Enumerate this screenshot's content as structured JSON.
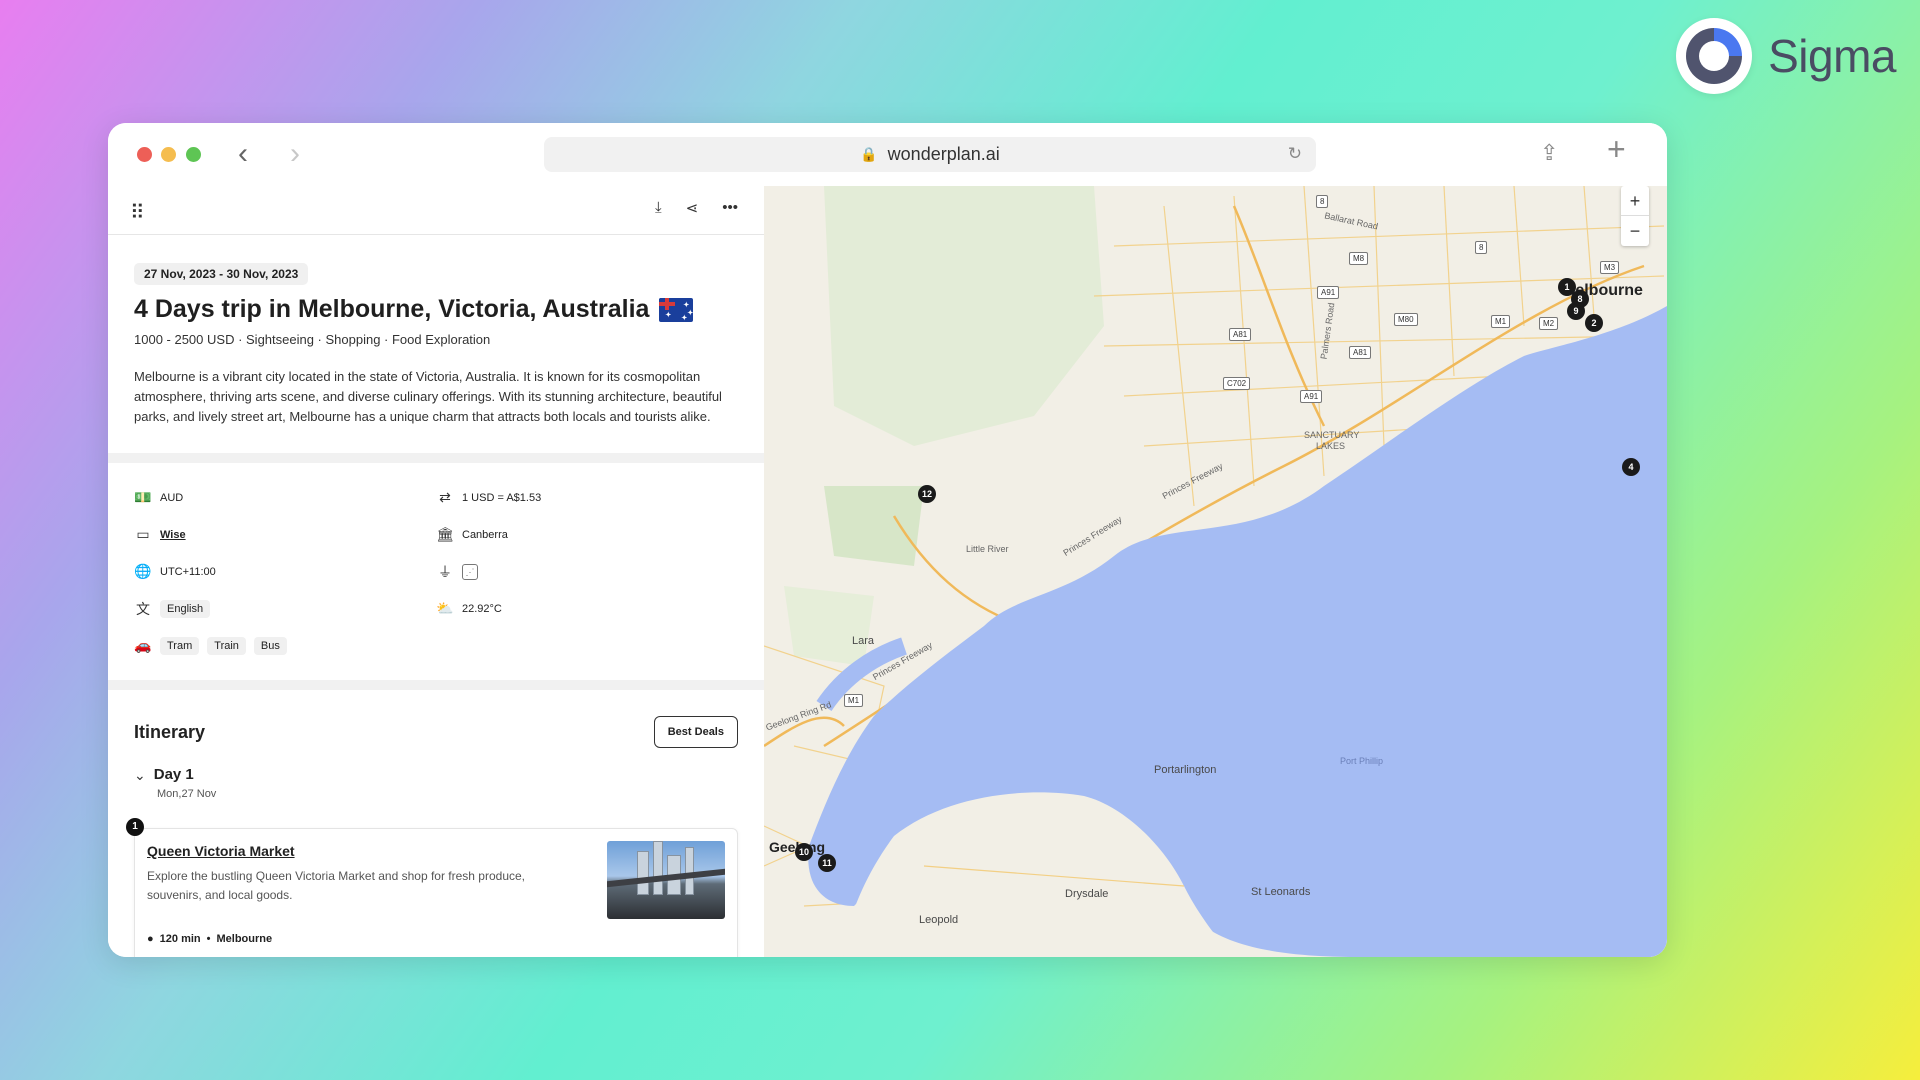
{
  "brand": {
    "name": "Sigma"
  },
  "browser": {
    "url": "wonderplan.ai"
  },
  "trip": {
    "dates": "27 Nov, 2023 - 30 Nov, 2023",
    "title": "4 Days trip in Melbourne, Victoria, Australia",
    "subtitle": "1000 - 2500 USD · Sightseeing · Shopping · Food Exploration",
    "description": "Melbourne is a vibrant city located in the state of Victoria, Australia. It is known for its cosmopolitan atmosphere, thriving arts scene, and diverse culinary offerings. With its stunning architecture, beautiful parks, and lively street art, Melbourne has a unique charm that attracts both locals and tourists alike."
  },
  "info": {
    "currency": "AUD",
    "exchange_rate": "1 USD = A$1.53",
    "payment": "Wise",
    "capital": "Canberra",
    "timezone": "UTC+11:00",
    "language": "English",
    "weather": "22.92°C",
    "transport": [
      "Tram",
      "Train",
      "Bus"
    ]
  },
  "itinerary": {
    "title": "Itinerary",
    "best_deals": "Best Deals",
    "day": {
      "label": "Day 1",
      "date": "Mon,27 Nov"
    },
    "place": {
      "number": "1",
      "name": "Queen Victoria Market",
      "description": "Explore the bustling Queen Victoria Market and shop for fresh produce, souvenirs, and local goods.",
      "duration": "120 min",
      "location": "Melbourne"
    }
  },
  "map": {
    "zoom_in": "+",
    "zoom_out": "−",
    "labels": {
      "melbourne": "Melbourne",
      "sanctuary_lakes_1": "SANCTUARY",
      "sanctuary_lakes_2": "LAKES",
      "little_river": "Little River",
      "lara": "Lara",
      "geelong": "Geelong",
      "portarlington": "Portarlington",
      "drysdale": "Drysdale",
      "st_leonards": "St Leonards",
      "leopold": "Leopold",
      "port_phillip": "Port Phillip",
      "princes_freeway": "Princes Freeway",
      "ballarat_road": "Ballarat Road",
      "palmers_road": "Palmers Road",
      "geelong_ring_rd": "Geelong Ring Rd"
    },
    "shields": [
      "8",
      "M8",
      "A91",
      "A81",
      "M80",
      "A81",
      "C702",
      "A91",
      "M1",
      "M2",
      "M3",
      "8",
      "M1"
    ],
    "pins": [
      "1",
      "8",
      "9",
      "2",
      "4",
      "12",
      "10",
      "11"
    ]
  }
}
